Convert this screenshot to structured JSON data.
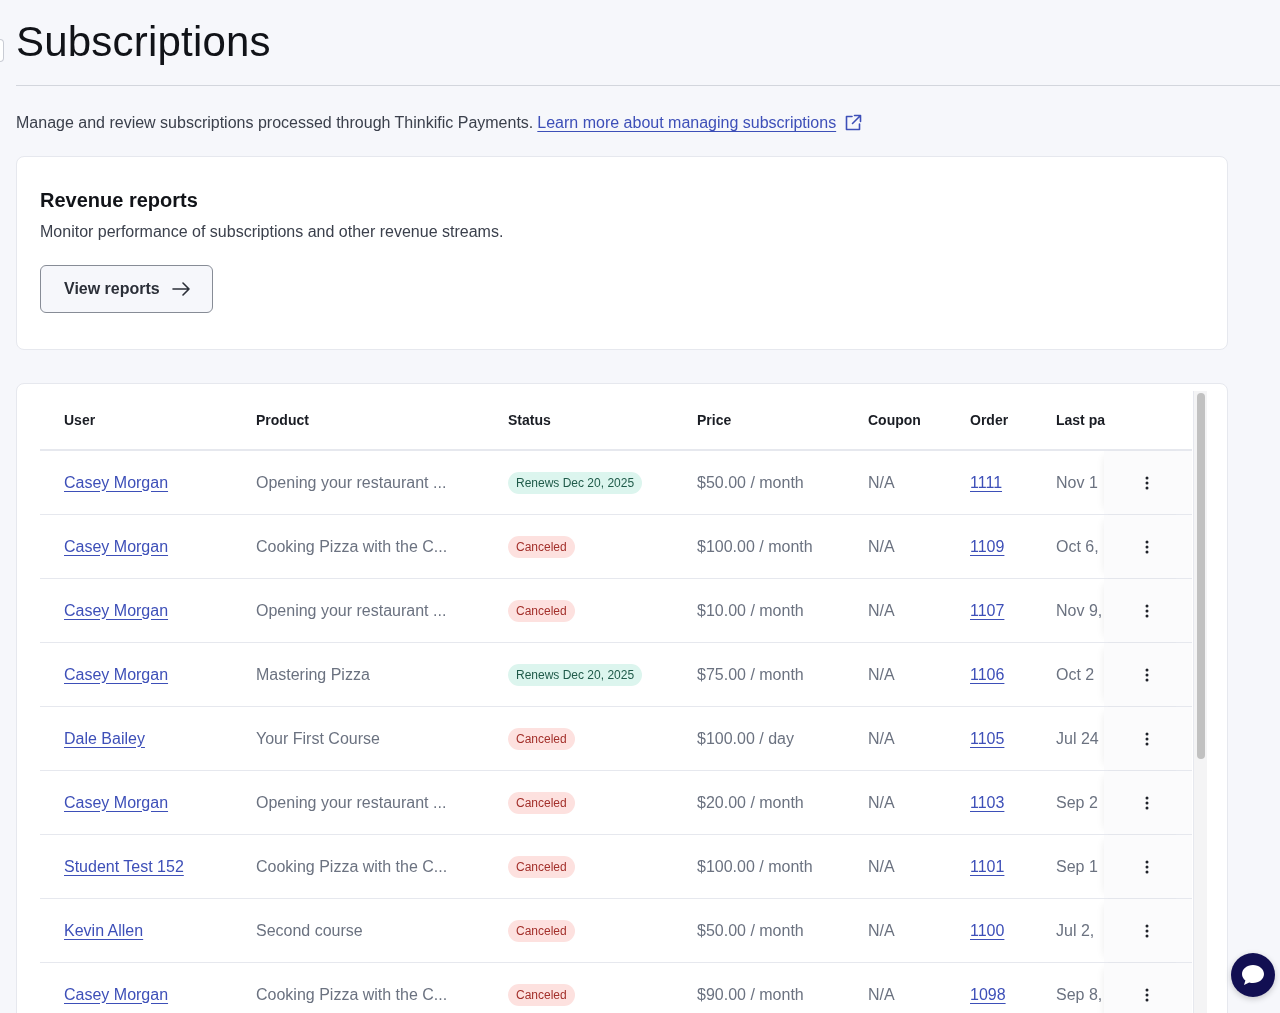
{
  "page": {
    "title": "Subscriptions",
    "description": "Manage and review subscriptions processed through Thinkific Payments.",
    "link": "Learn more about managing subscriptions"
  },
  "revenue_card": {
    "title": "Revenue reports",
    "description": "Monitor performance of subscriptions and other revenue streams.",
    "button": "View reports"
  },
  "table": {
    "columns": [
      "User",
      "Product",
      "Status",
      "Price",
      "Coupon",
      "Order",
      "Last pa"
    ],
    "rows": [
      {
        "user": "Casey Morgan",
        "product": "Opening your restaurant ...",
        "status": {
          "kind": "renews",
          "label": "Renews Dec 20, 2025"
        },
        "price": "$50.00 / month",
        "coupon": "N/A",
        "order": "1111",
        "last_paid": "Nov 1"
      },
      {
        "user": "Casey Morgan",
        "product": "Cooking Pizza with the C...",
        "status": {
          "kind": "canceled",
          "label": "Canceled"
        },
        "price": "$100.00 / month",
        "coupon": "N/A",
        "order": "1109",
        "last_paid": "Oct 6,"
      },
      {
        "user": "Casey Morgan",
        "product": "Opening your restaurant ...",
        "status": {
          "kind": "canceled",
          "label": "Canceled"
        },
        "price": "$10.00 / month",
        "coupon": "N/A",
        "order": "1107",
        "last_paid": "Nov 9,"
      },
      {
        "user": "Casey Morgan",
        "product": "Mastering Pizza",
        "status": {
          "kind": "renews",
          "label": "Renews Dec 20, 2025"
        },
        "price": "$75.00 / month",
        "coupon": "N/A",
        "order": "1106",
        "last_paid": "Oct 2"
      },
      {
        "user": "Dale Bailey",
        "product": "Your First Course",
        "status": {
          "kind": "canceled",
          "label": "Canceled"
        },
        "price": "$100.00 / day",
        "coupon": "N/A",
        "order": "1105",
        "last_paid": "Jul 24"
      },
      {
        "user": "Casey Morgan",
        "product": "Opening your restaurant ...",
        "status": {
          "kind": "canceled",
          "label": "Canceled"
        },
        "price": "$20.00 / month",
        "coupon": "N/A",
        "order": "1103",
        "last_paid": "Sep 2"
      },
      {
        "user": "Student Test 152",
        "product": "Cooking Pizza with the C...",
        "status": {
          "kind": "canceled",
          "label": "Canceled"
        },
        "price": "$100.00 / month",
        "coupon": "N/A",
        "order": "1101",
        "last_paid": "Sep 1"
      },
      {
        "user": "Kevin Allen",
        "product": "Second course",
        "status": {
          "kind": "canceled",
          "label": "Canceled"
        },
        "price": "$50.00 / month",
        "coupon": "N/A",
        "order": "1100",
        "last_paid": "Jul 2,"
      },
      {
        "user": "Casey Morgan",
        "product": "Cooking Pizza with the C...",
        "status": {
          "kind": "canceled",
          "label": "Canceled"
        },
        "price": "$90.00 / month",
        "coupon": "N/A",
        "order": "1098",
        "last_paid": "Sep 8,"
      }
    ]
  }
}
